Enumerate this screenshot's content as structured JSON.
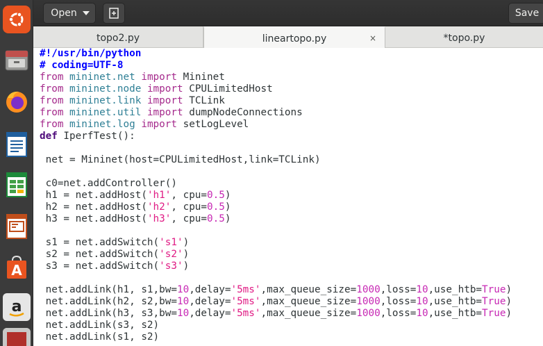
{
  "header": {
    "open_label": "Open",
    "save_label": "Save"
  },
  "tabs": [
    {
      "label": "topo2.py"
    },
    {
      "label": "lineartopo.py",
      "active": true,
      "close": "×"
    },
    {
      "label": "*topo.py"
    }
  ],
  "dock": {
    "items": [
      {
        "name": "ubuntu-logo-icon"
      },
      {
        "name": "file-manager-icon"
      },
      {
        "name": "firefox-icon"
      },
      {
        "name": "writer-icon"
      },
      {
        "name": "calc-icon"
      },
      {
        "name": "impress-icon"
      },
      {
        "name": "software-center-icon"
      },
      {
        "name": "amazon-icon"
      }
    ]
  },
  "colors": {
    "keyword": "#a52a8c",
    "module": "#2e7f95",
    "string": "#e01b84",
    "number": "#c728b4",
    "comment": "#0000ff"
  },
  "code": [
    [
      [
        "cm",
        "#!/usr/bin/python"
      ]
    ],
    [
      [
        "cm",
        "# coding=UTF-8"
      ]
    ],
    [
      [
        "kw",
        "from"
      ],
      [
        "t",
        " "
      ],
      [
        "mod",
        "mininet.net"
      ],
      [
        "t",
        " "
      ],
      [
        "kw",
        "import"
      ],
      [
        "t",
        " Mininet"
      ]
    ],
    [
      [
        "kw",
        "from"
      ],
      [
        "t",
        " "
      ],
      [
        "mod",
        "mininet.node"
      ],
      [
        "t",
        " "
      ],
      [
        "kw",
        "import"
      ],
      [
        "t",
        " CPULimitedHost"
      ]
    ],
    [
      [
        "kw",
        "from"
      ],
      [
        "t",
        " "
      ],
      [
        "mod",
        "mininet.link"
      ],
      [
        "t",
        " "
      ],
      [
        "kw",
        "import"
      ],
      [
        "t",
        " TCLink"
      ]
    ],
    [
      [
        "kw",
        "from"
      ],
      [
        "t",
        " "
      ],
      [
        "mod",
        "mininet.util"
      ],
      [
        "t",
        " "
      ],
      [
        "kw",
        "import"
      ],
      [
        "t",
        " dumpNodeConnections"
      ]
    ],
    [
      [
        "kw",
        "from"
      ],
      [
        "t",
        " "
      ],
      [
        "mod",
        "mininet.log"
      ],
      [
        "t",
        " "
      ],
      [
        "kw",
        "import"
      ],
      [
        "t",
        " setLogLevel"
      ]
    ],
    [
      [
        "def",
        "def"
      ],
      [
        "t",
        " IperfTest():"
      ]
    ],
    [],
    [
      [
        "t",
        " net = Mininet(host=CPULimitedHost,link=TCLink)"
      ]
    ],
    [],
    [
      [
        "t",
        " c0=net.addController()"
      ]
    ],
    [
      [
        "t",
        " h1 = net.addHost("
      ],
      [
        "str",
        "'h1'"
      ],
      [
        "t",
        ", cpu="
      ],
      [
        "num",
        "0.5"
      ],
      [
        "t",
        ")"
      ]
    ],
    [
      [
        "t",
        " h2 = net.addHost("
      ],
      [
        "str",
        "'h2'"
      ],
      [
        "t",
        ", cpu="
      ],
      [
        "num",
        "0.5"
      ],
      [
        "t",
        ")"
      ]
    ],
    [
      [
        "t",
        " h3 = net.addHost("
      ],
      [
        "str",
        "'h3'"
      ],
      [
        "t",
        ", cpu="
      ],
      [
        "num",
        "0.5"
      ],
      [
        "t",
        ")"
      ]
    ],
    [],
    [
      [
        "t",
        " s1 = net.addSwitch("
      ],
      [
        "str",
        "'s1'"
      ],
      [
        "t",
        ")"
      ]
    ],
    [
      [
        "t",
        " s2 = net.addSwitch("
      ],
      [
        "str",
        "'s2'"
      ],
      [
        "t",
        ")"
      ]
    ],
    [
      [
        "t",
        " s3 = net.addSwitch("
      ],
      [
        "str",
        "'s3'"
      ],
      [
        "t",
        ")"
      ]
    ],
    [],
    [
      [
        "t",
        " net.addLink(h1, s1,bw="
      ],
      [
        "num",
        "10"
      ],
      [
        "t",
        ",delay="
      ],
      [
        "str",
        "'5ms'"
      ],
      [
        "t",
        ",max_queue_size="
      ],
      [
        "num",
        "1000"
      ],
      [
        "t",
        ",loss="
      ],
      [
        "num",
        "10"
      ],
      [
        "t",
        ",use_htb="
      ],
      [
        "bi",
        "True"
      ],
      [
        "t",
        ")"
      ]
    ],
    [
      [
        "t",
        " net.addLink(h2, s2,bw="
      ],
      [
        "num",
        "10"
      ],
      [
        "t",
        ",delay="
      ],
      [
        "str",
        "'5ms'"
      ],
      [
        "t",
        ",max_queue_size="
      ],
      [
        "num",
        "1000"
      ],
      [
        "t",
        ",loss="
      ],
      [
        "num",
        "10"
      ],
      [
        "t",
        ",use_htb="
      ],
      [
        "bi",
        "True"
      ],
      [
        "t",
        ")"
      ]
    ],
    [
      [
        "t",
        " net.addLink(h3, s3,bw="
      ],
      [
        "num",
        "10"
      ],
      [
        "t",
        ",delay="
      ],
      [
        "str",
        "'5ms'"
      ],
      [
        "t",
        ",max_queue_size="
      ],
      [
        "num",
        "1000"
      ],
      [
        "t",
        ",loss="
      ],
      [
        "num",
        "10"
      ],
      [
        "t",
        ",use_htb="
      ],
      [
        "bi",
        "True"
      ],
      [
        "t",
        ")"
      ]
    ],
    [
      [
        "t",
        " net.addLink(s3, s2)"
      ]
    ],
    [
      [
        "t",
        " net.addLink(s1, s2)"
      ]
    ]
  ]
}
